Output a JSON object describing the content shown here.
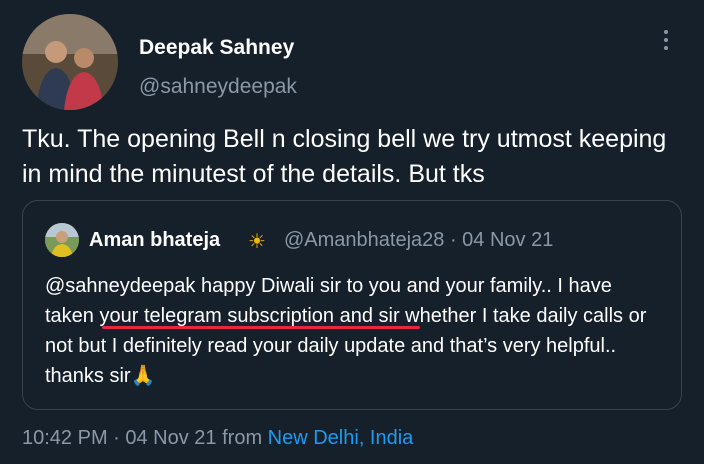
{
  "tweet": {
    "author_name": "Deepak Sahney",
    "author_handle": "@sahneydeepak",
    "text": "Tku. The opening Bell n closing bell we try utmost keeping in mind the minutest of the details. But tks",
    "timestamp": "10:42 PM · 04 Nov 21 from ",
    "location": "New Delhi, India"
  },
  "quoted": {
    "author_name": "Aman bhateja",
    "badge_emoji": "☀",
    "meta": "@Amanbhateja28 · 04 Nov 21",
    "text": "@sahneydeepak happy Diwali sir to you and your family.. I have taken your telegram subscription and sir whether I take daily calls or not but I definitely read your daily update and that’s very helpful.. thanks sir🙏"
  },
  "colors": {
    "background": "#15202b",
    "secondary_text": "#8b98a5",
    "link": "#1d9bf0",
    "annotation_underline": "#e8263c"
  },
  "icons": {
    "more": "more-options-icon"
  }
}
